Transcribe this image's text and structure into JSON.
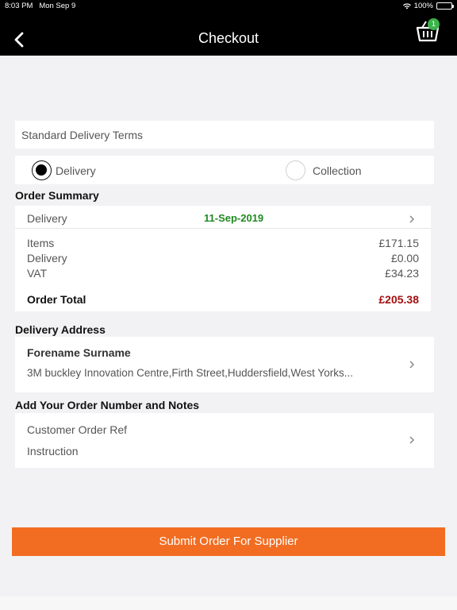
{
  "status_bar": {
    "time": "8:03 PM",
    "date": "Mon Sep 9",
    "battery": "100%"
  },
  "nav": {
    "title": "Checkout",
    "basket_count": "1"
  },
  "delivery_terms": "Standard Delivery Terms",
  "delivery_method": {
    "options": [
      {
        "label": "Delivery",
        "selected": true
      },
      {
        "label": "Collection",
        "selected": false
      }
    ]
  },
  "order_summary": {
    "title": "Order Summary",
    "delivery_label": "Delivery",
    "delivery_date": "11-Sep-2019",
    "lines": [
      {
        "label": "Items",
        "value": "£171.15"
      },
      {
        "label": "Delivery",
        "value": "£0.00"
      },
      {
        "label": "VAT",
        "value": "£34.23"
      }
    ],
    "total_label": "Order Total",
    "total_value": "£205.38"
  },
  "delivery_address": {
    "title": "Delivery Address",
    "name": "Forename Surname",
    "address": "3M buckley Innovation Centre,Firth Street,Huddersfield,West Yorks..."
  },
  "order_notes": {
    "title": "Add Your Order Number and Notes",
    "order_ref_placeholder": "Customer Order Ref",
    "instruction_placeholder": "Instruction"
  },
  "submit_label": "Submit Order For Supplier",
  "colors": {
    "accent": "#f26d22",
    "date_green": "#1f8a1f",
    "total_red": "#a50f0f",
    "badge_green": "#3cb34a"
  }
}
